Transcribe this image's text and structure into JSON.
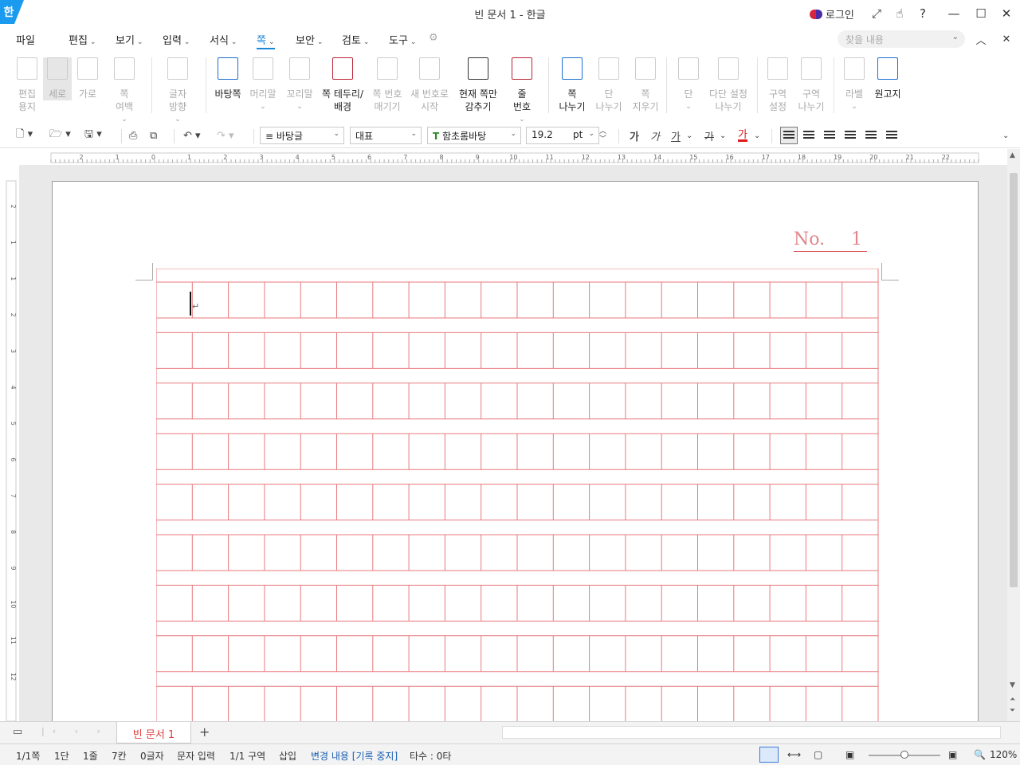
{
  "app": {
    "logo": "한",
    "title": "빈 문서 1 - 한글",
    "login": "로그인"
  },
  "menu": [
    {
      "label": "파일",
      "chev": false,
      "active": false
    },
    {
      "label": "편집",
      "chev": true,
      "active": false
    },
    {
      "label": "보기",
      "chev": true,
      "active": false
    },
    {
      "label": "입력",
      "chev": true,
      "active": false
    },
    {
      "label": "서식",
      "chev": true,
      "active": false
    },
    {
      "label": "쪽",
      "chev": true,
      "active": true
    },
    {
      "label": "보안",
      "chev": true,
      "active": false
    },
    {
      "label": "검토",
      "chev": true,
      "active": false
    },
    {
      "label": "도구",
      "chev": true,
      "active": false
    }
  ],
  "search": {
    "placeholder": "찾을 내용"
  },
  "ribbon": [
    {
      "lines": [
        "편집",
        "용지"
      ],
      "disabled": true,
      "selected": false,
      "dropdown": false
    },
    {
      "lines": [
        "세로"
      ],
      "disabled": true,
      "selected": true,
      "dropdown": false
    },
    {
      "lines": [
        "가로"
      ],
      "disabled": true,
      "selected": false,
      "dropdown": false
    },
    {
      "lines": [
        "쪽",
        "여백"
      ],
      "disabled": true,
      "selected": false,
      "dropdown": true
    },
    {
      "lines": [
        "글자",
        "방향"
      ],
      "disabled": true,
      "selected": false,
      "dropdown": true
    },
    {
      "lines": [
        "바탕쪽"
      ],
      "disabled": false,
      "selected": false,
      "dropdown": false
    },
    {
      "lines": [
        "머리말"
      ],
      "disabled": true,
      "selected": false,
      "dropdown": true
    },
    {
      "lines": [
        "꼬리말"
      ],
      "disabled": true,
      "selected": false,
      "dropdown": true
    },
    {
      "lines": [
        "쪽 테두리/",
        "배경"
      ],
      "disabled": false,
      "selected": false,
      "dropdown": false
    },
    {
      "lines": [
        "쪽 번호",
        "매기기"
      ],
      "disabled": true,
      "selected": false,
      "dropdown": false
    },
    {
      "lines": [
        "새 번호로",
        "시작"
      ],
      "disabled": true,
      "selected": false,
      "dropdown": false
    },
    {
      "lines": [
        "현재 쪽만",
        "감추기"
      ],
      "disabled": false,
      "selected": false,
      "dropdown": false
    },
    {
      "lines": [
        "줄",
        "번호"
      ],
      "disabled": false,
      "selected": false,
      "dropdown": true
    },
    {
      "lines": [
        "쪽",
        "나누기"
      ],
      "disabled": false,
      "selected": false,
      "dropdown": false
    },
    {
      "lines": [
        "단",
        "나누기"
      ],
      "disabled": true,
      "selected": false,
      "dropdown": false
    },
    {
      "lines": [
        "쪽",
        "지우기"
      ],
      "disabled": true,
      "selected": false,
      "dropdown": false
    },
    {
      "lines": [
        "단"
      ],
      "disabled": true,
      "selected": false,
      "dropdown": true
    },
    {
      "lines": [
        "다단 설정",
        "나누기"
      ],
      "disabled": true,
      "selected": false,
      "dropdown": false
    },
    {
      "lines": [
        "구역",
        "설정"
      ],
      "disabled": true,
      "selected": false,
      "dropdown": false
    },
    {
      "lines": [
        "구역",
        "나누기"
      ],
      "disabled": true,
      "selected": false,
      "dropdown": false
    },
    {
      "lines": [
        "라벨"
      ],
      "disabled": true,
      "selected": false,
      "dropdown": true
    },
    {
      "lines": [
        "원고지"
      ],
      "disabled": false,
      "selected": false,
      "dropdown": false
    }
  ],
  "toolbar": {
    "style": "바탕글",
    "lang": "대표",
    "font": "함초롬바탕",
    "font_size": "19.2",
    "font_unit": "pt",
    "fmt": [
      "가",
      "가",
      "가",
      "가",
      "가"
    ]
  },
  "ruler": {
    "h_labels": [
      "2",
      "1",
      "0",
      "1",
      "2",
      "3",
      "4",
      "5",
      "6",
      "7",
      "8",
      "9",
      "10",
      "11",
      "12",
      "13",
      "14",
      "15",
      "16",
      "17",
      "18",
      "19",
      "20",
      "21",
      "22"
    ],
    "v_labels": [
      "2",
      "1",
      "1",
      "2",
      "3",
      "4",
      "5",
      "6",
      "7",
      "8",
      "9",
      "10",
      "11",
      "12"
    ]
  },
  "page": {
    "no_label": "No.",
    "no_value": "1",
    "paragraph_mark": "↵"
  },
  "tabs": {
    "doc": "빈 문서 1",
    "add": "+"
  },
  "status": [
    {
      "text": "1/1쪽",
      "blue": false
    },
    {
      "text": "1단",
      "blue": false
    },
    {
      "text": "1줄",
      "blue": false
    },
    {
      "text": "7칸",
      "blue": false
    },
    {
      "text": "0글자",
      "blue": false
    },
    {
      "text": "문자 입력",
      "blue": false
    },
    {
      "text": "1/1 구역",
      "blue": false
    },
    {
      "text": "삽입",
      "blue": false
    },
    {
      "text": "변경 내용 [기록 중지]",
      "blue": true
    },
    {
      "text": "타수 : 0타",
      "blue": false
    }
  ],
  "zoom": {
    "label": "120%",
    "level": 0.5
  },
  "colors": {
    "accent": "#1a86d8",
    "grid": "#e8797d",
    "tab_text": "#e03e3e",
    "blue_status": "#1a5fb4"
  }
}
